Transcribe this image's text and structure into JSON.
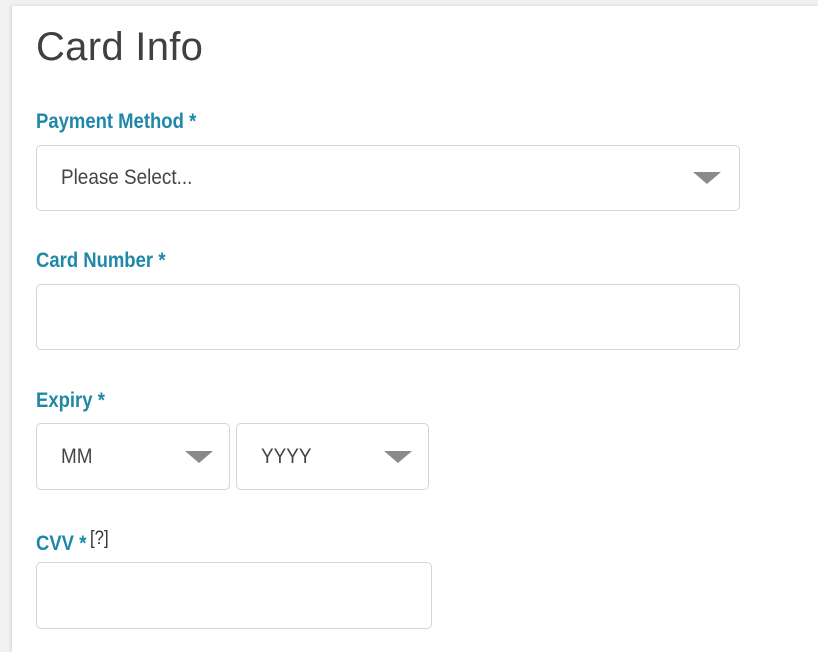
{
  "form": {
    "title": "Card Info",
    "payment_method": {
      "label": "Payment Method",
      "required_marker": "*",
      "selected": "Please Select..."
    },
    "card_number": {
      "label": "Card Number",
      "required_marker": "*",
      "value": ""
    },
    "expiry": {
      "label": "Expiry",
      "required_marker": "*",
      "month_selected": "MM",
      "year_selected": "YYYY"
    },
    "cvv": {
      "label": "CVV",
      "required_marker": "*",
      "help_link": "[?]",
      "value": ""
    }
  },
  "icons": {
    "dropdown": "chevron-down-icon"
  },
  "colors": {
    "label": "#1f88a8",
    "title": "#404040",
    "border": "#d5d5d5",
    "caret": "#8a8a8a",
    "background": "#f1f1f1"
  }
}
